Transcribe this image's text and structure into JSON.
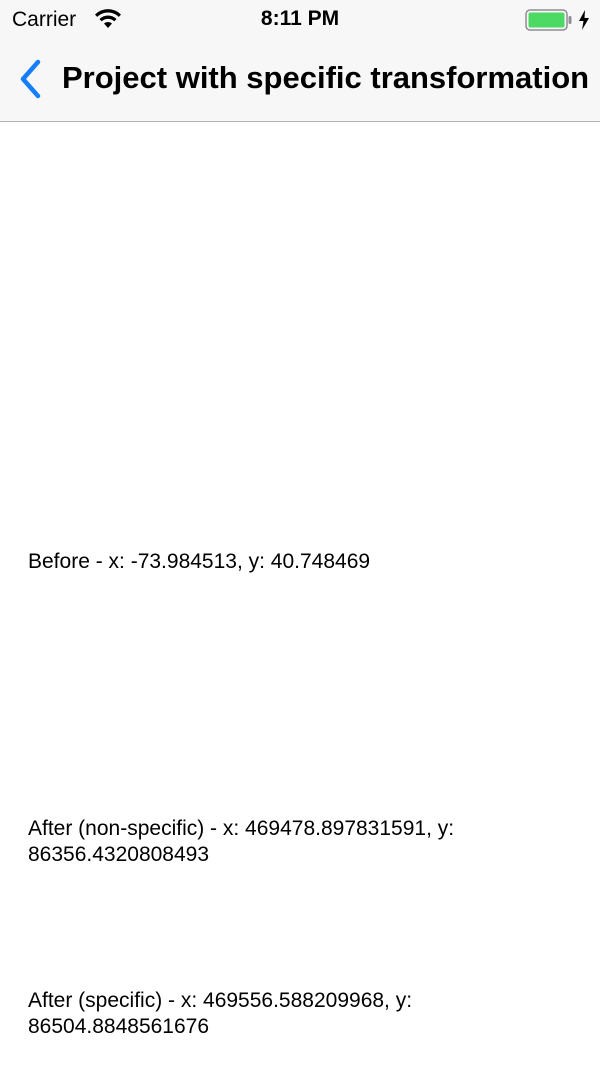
{
  "status_bar": {
    "carrier": "Carrier",
    "time": "8:11 PM",
    "battery_color": "#4cd964",
    "icons": [
      "wifi-icon",
      "battery-icon",
      "charging-bolt-icon"
    ]
  },
  "nav_bar": {
    "title": "Project with specific transformation",
    "back_icon": "chevron-left-icon",
    "accent_color": "#147efb"
  },
  "results": {
    "before": "Before - x: -73.984513, y: 40.748469",
    "after_nonspecific": "After (non-specific) - x: 469478.897831591, y: 86356.4320808493",
    "after_specific": "After (specific) - x: 469556.588209968, y: 86504.8848561676"
  }
}
